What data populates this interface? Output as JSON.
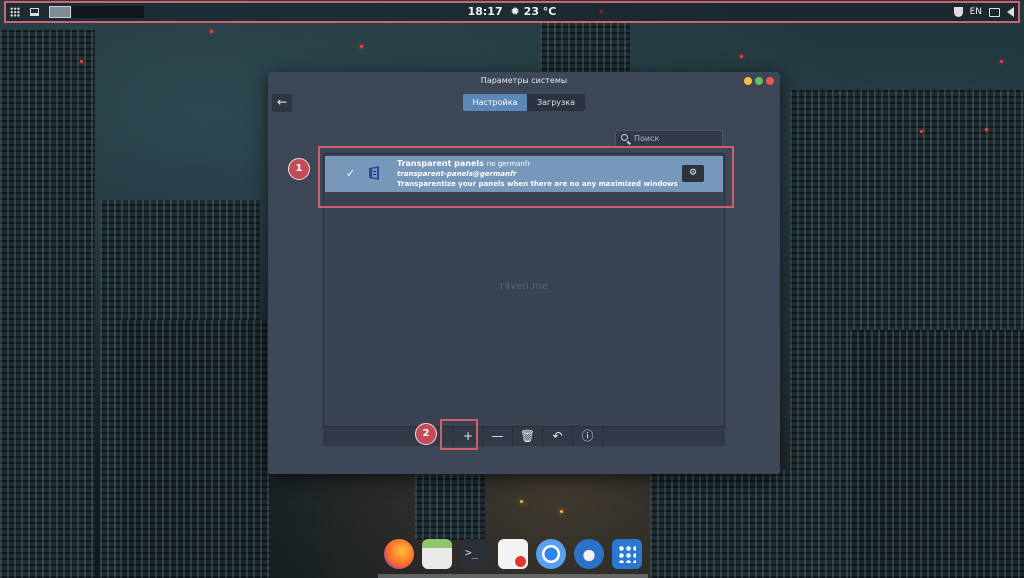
{
  "topbar": {
    "time": "18:17",
    "weather_icon": "sun-icon",
    "temperature": "23 °C",
    "keyboard_layout": "EN"
  },
  "window": {
    "title": "Параметры системы",
    "tabs": [
      {
        "label": "Настройка",
        "active": true
      },
      {
        "label": "Загрузка",
        "active": false
      }
    ],
    "search_placeholder": "Поиск",
    "extension": {
      "name": "Transparent panels",
      "author": "по germanfr",
      "uuid": "transparent-panels@germanfr",
      "description": "Transparentize your panels when there are no any maximized windows"
    },
    "watermark": "r4ven.me",
    "toolbar_buttons": [
      "add-icon",
      "remove-icon",
      "trash-icon",
      "undo-icon",
      "info-icon"
    ]
  },
  "annotations": {
    "badge_1": "1",
    "badge_2": "2",
    "highlight_color": "#cf5f69"
  },
  "dock": {
    "items": [
      "firefox-icon",
      "files-icon",
      "terminal-icon",
      "text-editor-icon",
      "chromium-icon",
      "thunderbird-icon",
      "software-icon"
    ]
  },
  "colors": {
    "accent": "#5b88b4",
    "selected_row": "#7898bb",
    "window_bg": "#3d4757"
  }
}
